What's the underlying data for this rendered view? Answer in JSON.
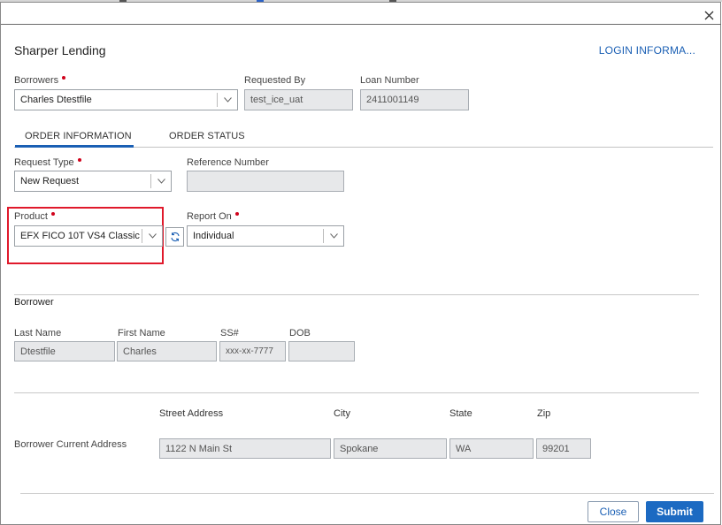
{
  "header": {
    "title": "Sharper Lending",
    "login_link": "LOGIN INFORMA..."
  },
  "borrowers": {
    "label": "Borrowers",
    "value": "Charles Dtestfile",
    "required": true
  },
  "requested_by": {
    "label": "Requested By",
    "value": "test_ice_uat"
  },
  "loan_number": {
    "label": "Loan Number",
    "value": "2411001149"
  },
  "tabs": [
    {
      "label": "ORDER INFORMATION",
      "active": true
    },
    {
      "label": "ORDER STATUS",
      "active": false
    }
  ],
  "request_type": {
    "label": "Request Type",
    "value": "New Request",
    "required": true
  },
  "reference_number": {
    "label": "Reference Number",
    "value": ""
  },
  "product": {
    "label": "Product",
    "value": "EFX FICO 10T VS4 Classic",
    "required": true
  },
  "report_on": {
    "label": "Report On",
    "value": "Individual",
    "required": true
  },
  "borrower_section": {
    "title": "Borrower",
    "last_name": {
      "label": "Last Name",
      "value": "Dtestfile"
    },
    "first_name": {
      "label": "First Name",
      "value": "Charles"
    },
    "ssn": {
      "label": "SS#",
      "value": "xxx-xx-7777"
    },
    "dob": {
      "label": "DOB",
      "value": ""
    }
  },
  "address": {
    "row_label": "Borrower Current Address",
    "headers": {
      "street": "Street Address",
      "city": "City",
      "state": "State",
      "zip": "Zip"
    },
    "values": {
      "street": "1122 N Main St",
      "city": "Spokane",
      "state": "WA",
      "zip": "99201"
    }
  },
  "footer": {
    "close_label": "Close",
    "submit_label": "Submit"
  },
  "colors": {
    "accent": "#1a5fb4",
    "required": "#d0021b",
    "highlight": "#e0192b",
    "submit_bg": "#1c6ac2"
  }
}
